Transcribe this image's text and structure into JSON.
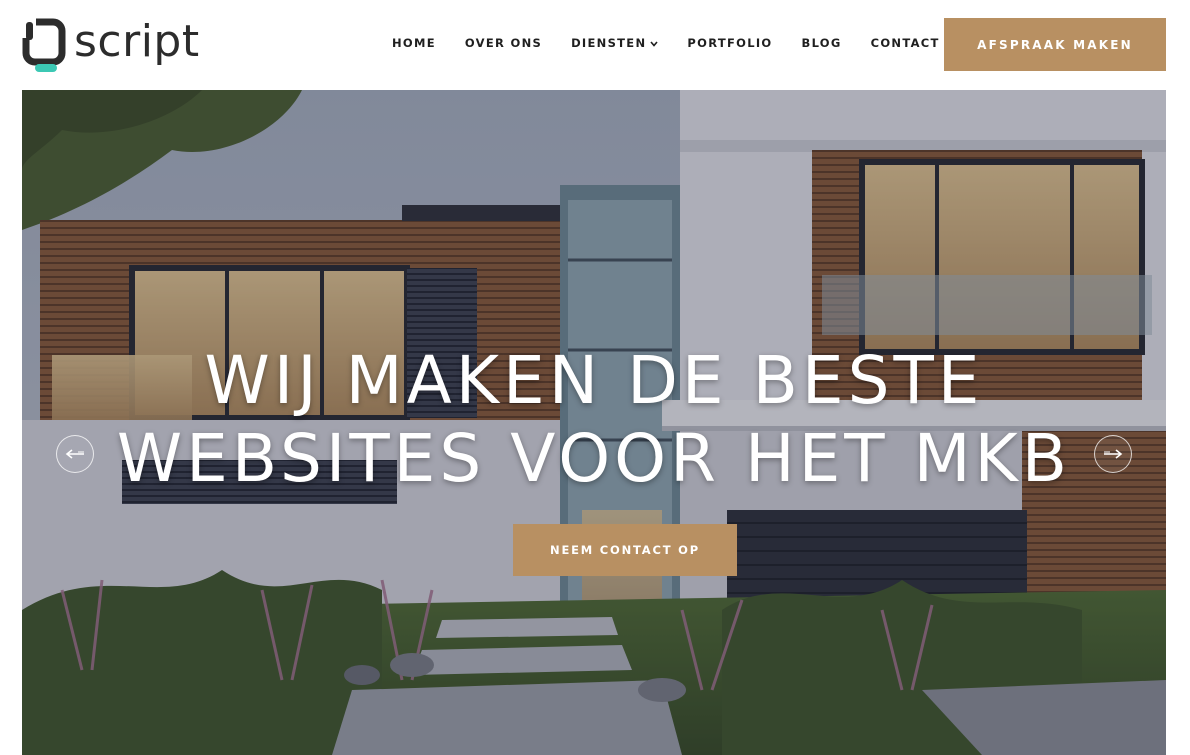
{
  "brand": {
    "wordmark": "script",
    "accent_color": "#3cc8b4",
    "text_color": "#2c2c2c"
  },
  "nav": {
    "items": [
      {
        "label": "HOME"
      },
      {
        "label": "OVER ONS"
      },
      {
        "label": "DIENSTEN",
        "has_dropdown": true
      },
      {
        "label": "PORTFOLIO"
      },
      {
        "label": "BLOG"
      },
      {
        "label": "CONTACT"
      }
    ],
    "cta_label": "AFSPRAAK MAKEN"
  },
  "hero": {
    "headline_line1": "WIJ MAKEN DE BESTE",
    "headline_line2": "WEBSITES VOOR HET MKB",
    "cta_label": "NEEM CONTACT OP",
    "prev_icon": "arrow-left-icon",
    "next_icon": "arrow-right-icon",
    "background": "modern house photo"
  },
  "colors": {
    "button": "#b89062",
    "button_text": "#ffffff",
    "nav_text": "#1f1f1f"
  }
}
